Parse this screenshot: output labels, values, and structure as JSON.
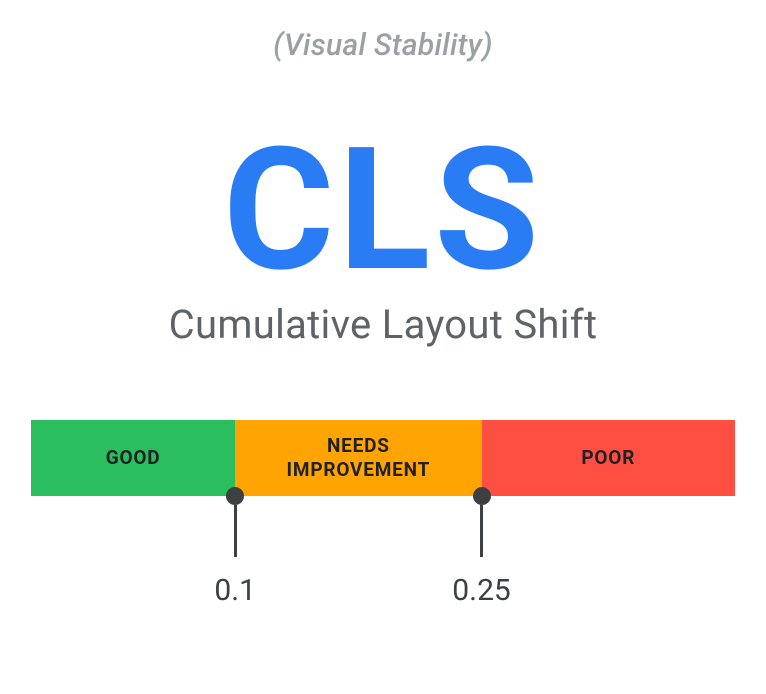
{
  "subtitle": "(Visual Stability)",
  "abbr": "CLS",
  "fullname": "Cumulative Layout Shift",
  "segments": {
    "good": {
      "label": "GOOD",
      "color": "#2abe5f"
    },
    "needs": {
      "label": "NEEDS\nIMPROVEMENT",
      "color": "#ffa400"
    },
    "poor": {
      "label": "POOR",
      "color": "#ff4e42"
    }
  },
  "thresholds": {
    "good_max": "0.1",
    "needs_max": "0.25"
  }
}
